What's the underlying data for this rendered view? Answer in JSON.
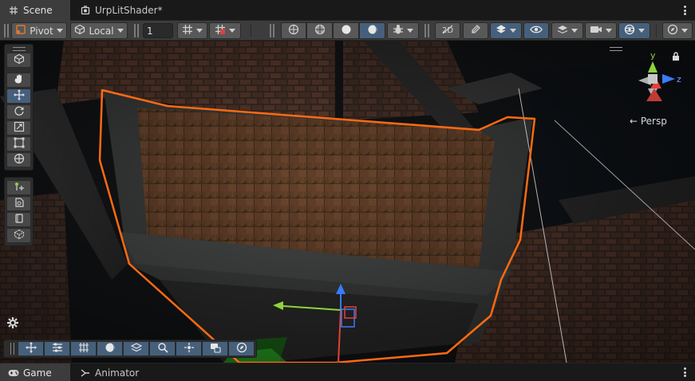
{
  "top_tabs": [
    {
      "label": "Scene",
      "icon": "scene-grid-icon",
      "active": true
    },
    {
      "label": "UrpLitShader*",
      "icon": "shader-icon",
      "active": false
    }
  ],
  "toolbar": {
    "pivot_label": "Pivot",
    "local_label": "Local",
    "snap_increment": "1"
  },
  "viewport": {
    "projection_label": "← Persp",
    "axes": {
      "x": "x",
      "y": "y",
      "z": "z"
    }
  },
  "bottom_tabs": [
    {
      "label": "Game",
      "icon": "gamepad-icon",
      "active": true
    },
    {
      "label": "Animator",
      "icon": "animator-icon",
      "active": false
    }
  ],
  "colors": {
    "selection_outline": "#ff6a12",
    "accent_on": "#46607c",
    "axis_x": "#e0413a",
    "axis_y": "#8fd33c",
    "axis_z": "#3a7bff"
  }
}
